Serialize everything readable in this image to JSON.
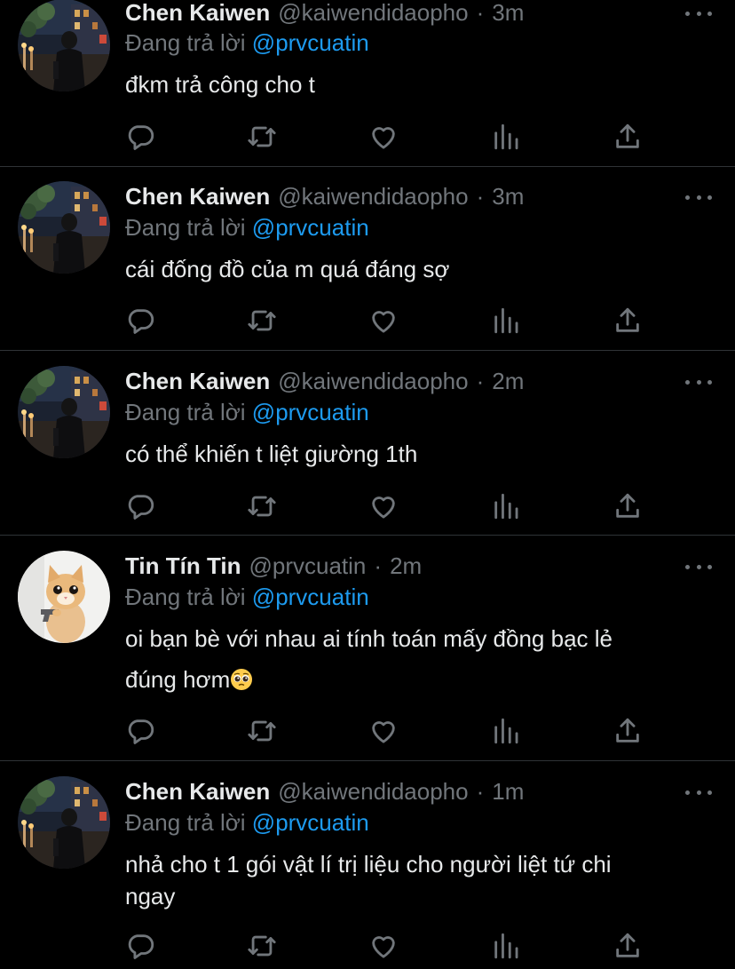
{
  "timeline": {
    "tweets": [
      {
        "author_name": "Chen Kaiwen",
        "author_handle": "@kaiwendidaopho",
        "separator": "·",
        "time": "3m",
        "replying_label": "Đang trả lời",
        "replying_to": "@prvcuatin",
        "text": "đkm trả công cho t",
        "avatar": "street-photo-avatar"
      },
      {
        "author_name": "Chen Kaiwen",
        "author_handle": "@kaiwendidaopho",
        "separator": "·",
        "time": "3m",
        "replying_label": "Đang trả lời",
        "replying_to": "@prvcuatin",
        "text": "cái đống đồ của m quá đáng sợ",
        "avatar": "street-photo-avatar"
      },
      {
        "author_name": "Chen Kaiwen",
        "author_handle": "@kaiwendidaopho",
        "separator": "·",
        "time": "2m",
        "replying_label": "Đang trả lời",
        "replying_to": "@prvcuatin",
        "text": "có thể khiến t liệt giường 1th",
        "avatar": "street-photo-avatar"
      },
      {
        "author_name": "Tin Tín Tin",
        "author_handle": "@prvcuatin",
        "separator": "·",
        "time": "2m",
        "replying_label": "Đang trả lời",
        "replying_to": "@prvcuatin",
        "text_line1": "oi bạn bè với nhau ai tính toán mấy đồng bạc lẻ",
        "text_line2": "đúng hơm",
        "emoji": "pleading-face-emoji",
        "avatar": "kitten-with-gun-avatar"
      },
      {
        "author_name": "Chen Kaiwen",
        "author_handle": "@kaiwendidaopho",
        "separator": "·",
        "time": "1m",
        "replying_label": "Đang trả lời",
        "replying_to": "@prvcuatin",
        "text_line1": "nhả cho t 1 gói vật lí trị liệu cho người liệt tứ chi",
        "text_line2": "ngay",
        "avatar": "street-photo-avatar"
      }
    ],
    "action_icons": [
      "reply-icon",
      "retweet-icon",
      "like-icon",
      "views-icon",
      "share-icon"
    ]
  },
  "colors": {
    "background": "#000000",
    "primary_text": "#e7e9ea",
    "secondary_text": "#71767b",
    "mention": "#1d9bf0",
    "divider": "#2f3336"
  }
}
